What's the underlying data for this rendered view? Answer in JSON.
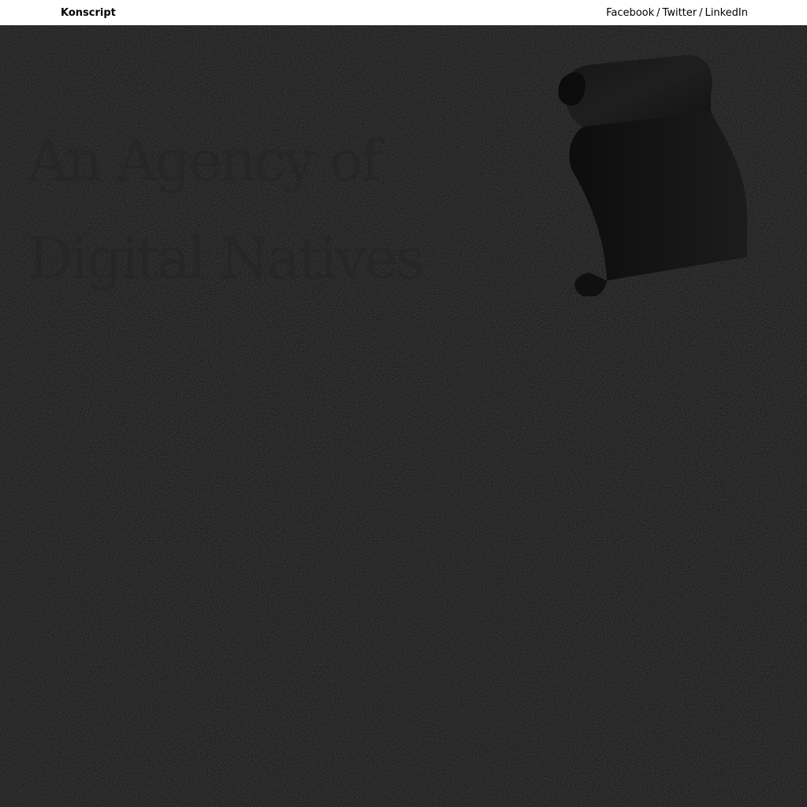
{
  "header": {
    "brand": "Konscript",
    "social": {
      "facebook": "Facebook",
      "separator": "/",
      "twitter": "Twitter",
      "linkedin": "LinkedIn"
    }
  },
  "hero": {
    "headline_line1": "An Agency of",
    "headline_line2": "Digital Natives",
    "decoration_icon": "scroll-ribbon-icon"
  },
  "colors": {
    "header_bg": "#ffffff",
    "page_bg": "#080808",
    "headline": "#262626",
    "ribbon": "#1c1c1c"
  }
}
